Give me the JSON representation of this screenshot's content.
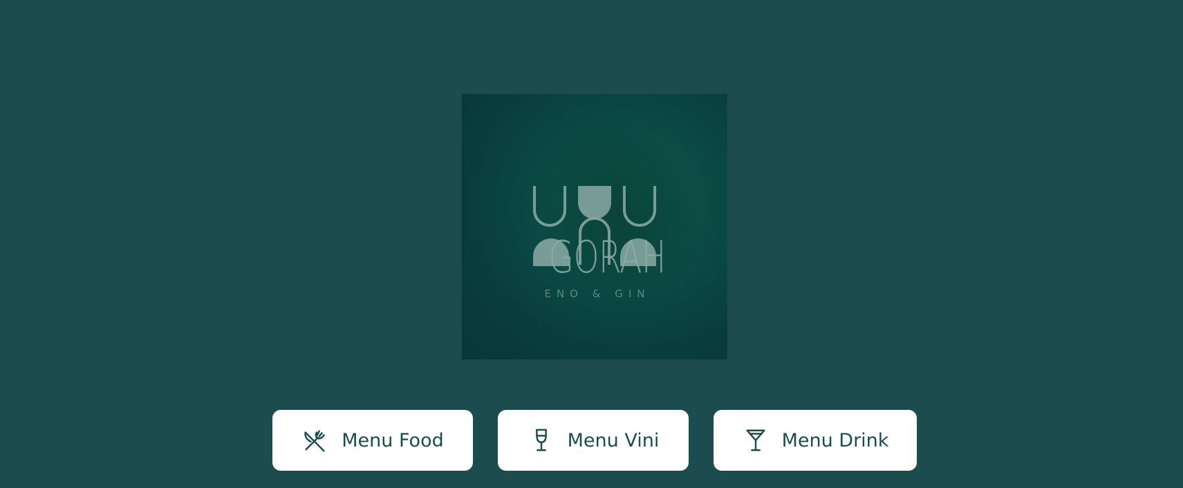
{
  "logo": {
    "wordmark": "GORAH",
    "tagline": "ENO & GIN"
  },
  "menu_buttons": [
    {
      "label": "Menu Food",
      "icon": "fork-knife-icon"
    },
    {
      "label": "Menu Vini",
      "icon": "wine-glass-icon"
    },
    {
      "label": "Menu Drink",
      "icon": "cocktail-glass-icon"
    }
  ],
  "colors": {
    "background": "#1c4c4d",
    "button_background": "#ffffff",
    "button_text": "#1c4c4d"
  }
}
